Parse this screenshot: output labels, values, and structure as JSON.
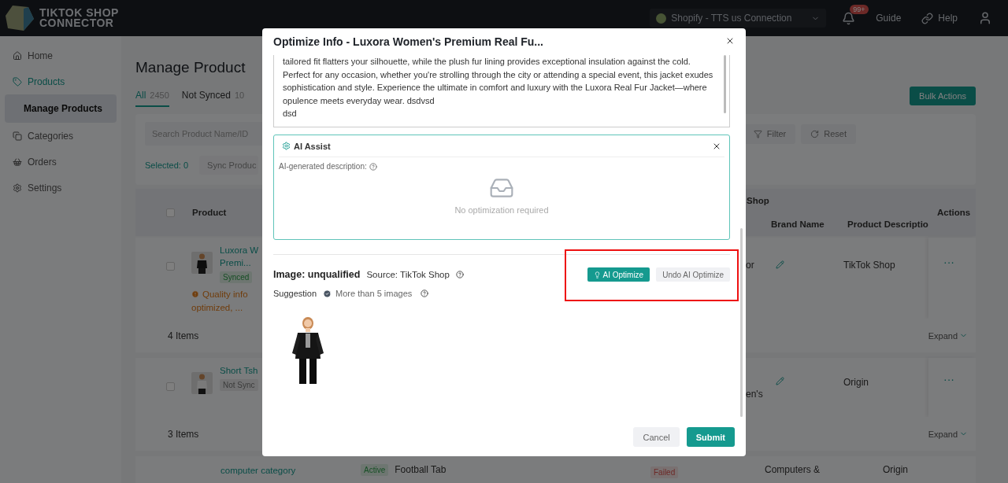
{
  "header": {
    "logo_lines": [
      "TIKTOK SHOP",
      "CONNECTOR"
    ],
    "connection": "Shopify - TTS us Connection",
    "notification_badge": "99+",
    "links": [
      "Guide",
      "Help"
    ]
  },
  "sidebar": {
    "items": [
      {
        "label": "Home",
        "selected": false
      },
      {
        "label": "Products",
        "selected": true,
        "children": [
          {
            "label": "Manage Products",
            "selected": true
          }
        ]
      },
      {
        "label": "Categories",
        "selected": false
      },
      {
        "label": "Orders",
        "selected": false
      },
      {
        "label": "Settings",
        "selected": false
      }
    ]
  },
  "page": {
    "title": "Manage Product",
    "bulk_action": "Bulk Actions",
    "tabs": [
      {
        "label": "All",
        "count": "2450",
        "selected": true
      },
      {
        "label": "Not Synced",
        "count": "10",
        "selected": false
      }
    ],
    "search": {
      "placeholder": "Search Product Name/ID"
    },
    "filter_buttons": [
      "Filter",
      "Reset"
    ],
    "selected_count": "Selected: 0",
    "sync_button": {
      "label": "Sync Produc",
      "disabled": true
    }
  },
  "table": {
    "select_all_checked": false,
    "product_header": "Product",
    "group_header": "Shop",
    "columns": [
      "Brand Name",
      "Product Descriptio"
    ],
    "actions_header": "Actions",
    "rows": [
      {
        "kind": "product",
        "checked": false,
        "name_lines": [
          "Luxora W",
          "Premi..."
        ],
        "status": "Synced",
        "synced": true,
        "warning_lines": [
          "Quality info",
          "optimized, ..."
        ],
        "cut_cell": "or",
        "description": "TikTok Shop",
        "actions": "···"
      },
      {
        "kind": "group",
        "count": "4 Items",
        "expand": "Expand"
      },
      {
        "kind": "product",
        "checked": false,
        "name_lines": [
          "Short Tsh"
        ],
        "status": "Not Sync",
        "synced": false,
        "cut_cell": "en's",
        "description": "Origin",
        "actions": "···"
      },
      {
        "kind": "group",
        "count": "3 Items",
        "expand": "Expand"
      },
      {
        "kind": "wide",
        "name": "computer category",
        "status": "Active",
        "category": "Football Tab",
        "sync_status": "Failed",
        "shop_category": "Computers &",
        "description": "Origin"
      }
    ]
  },
  "modal": {
    "title": "Optimize Info -  Luxora Women's Premium Real Fu...",
    "description": "tailored fit flatters your silhouette, while the plush fur lining provides exceptional insulation against the cold. Perfect for any occasion, whether you're strolling through the city or attending a special event, this jacket exudes sophistication and style. Experience the ultimate in comfort and luxury with the Luxora Real Fur Jacket—where opulence meets everyday wear. dsdvsd\ndsd",
    "ai_assist": {
      "title": "AI Assist",
      "label": "AI-generated description:",
      "empty": "No optimization required"
    },
    "image": {
      "title": "Image: unqualified",
      "source": "Source: TikTok Shop",
      "suggestion_label": "Suggestion",
      "suggestion": "More than 5 images"
    },
    "actions": [
      "AI Optimize",
      "Undo AI Optimize"
    ],
    "highlight": true,
    "footer": [
      "Cancel",
      "Submit"
    ]
  }
}
